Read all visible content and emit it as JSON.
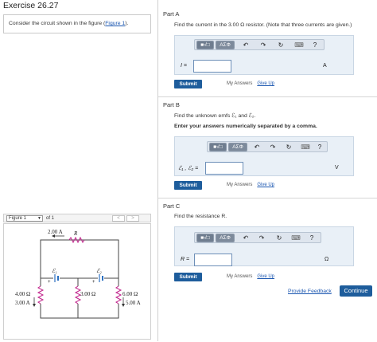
{
  "exercise": {
    "title": "Exercise 26.27",
    "question_prefix": "Consider the circuit shown in the figure (",
    "figure_link": "Figure 1",
    "question_suffix": ")."
  },
  "figure": {
    "select_value": "Figure 1",
    "of_label": "of 1",
    "prev_label": "<",
    "next_label": ">",
    "labels": {
      "current_top": "2.00 A",
      "resistor_r": "R",
      "emf1": "ℰ₁",
      "emf2": "ℰ₂",
      "plus_left": "+",
      "plus_right": "+",
      "r_left": "4.00 Ω",
      "i_left": "3.00 A",
      "r_mid": "3.00 Ω",
      "r_right": "6.00 Ω",
      "i_right": "5.00 A"
    }
  },
  "toolbar": {
    "templates": "■√□",
    "symbols": "ΑΣΦ",
    "undo": "↶",
    "redo": "↷",
    "reset": "↻",
    "keyboard": "⌨",
    "help": "?"
  },
  "parts": {
    "a": {
      "heading": "Part A",
      "prompt": "Find the current in the 3.00 Ω resistor. (Note that three currents are given.)",
      "var_label": "I =",
      "input_value": "",
      "unit": "A",
      "submit": "Submit",
      "my_answers": "My Answers",
      "give_up": "Give Up"
    },
    "b": {
      "heading": "Part B",
      "prompt": "Find the unknown emfs ℰ₁ and ℰ₂.",
      "instruction": "Enter your answers numerically separated by a comma.",
      "var_label": "ℰ₁ , ℰ₂ =",
      "input_value": "",
      "unit": "V",
      "submit": "Submit",
      "my_answers": "My Answers",
      "give_up": "Give Up"
    },
    "c": {
      "heading": "Part C",
      "prompt": "Find the resistance R.",
      "var_label": "R =",
      "input_value": "",
      "unit": "Ω",
      "submit": "Submit",
      "my_answers": "My Answers",
      "give_up": "Give Up"
    }
  },
  "footer": {
    "provide_feedback": "Provide Feedback",
    "continue": "Continue"
  },
  "colors": {
    "accent": "#1e5d9c",
    "link": "#1a56b0",
    "resistor": "#c0208a",
    "battery": "#2a6fc0"
  }
}
